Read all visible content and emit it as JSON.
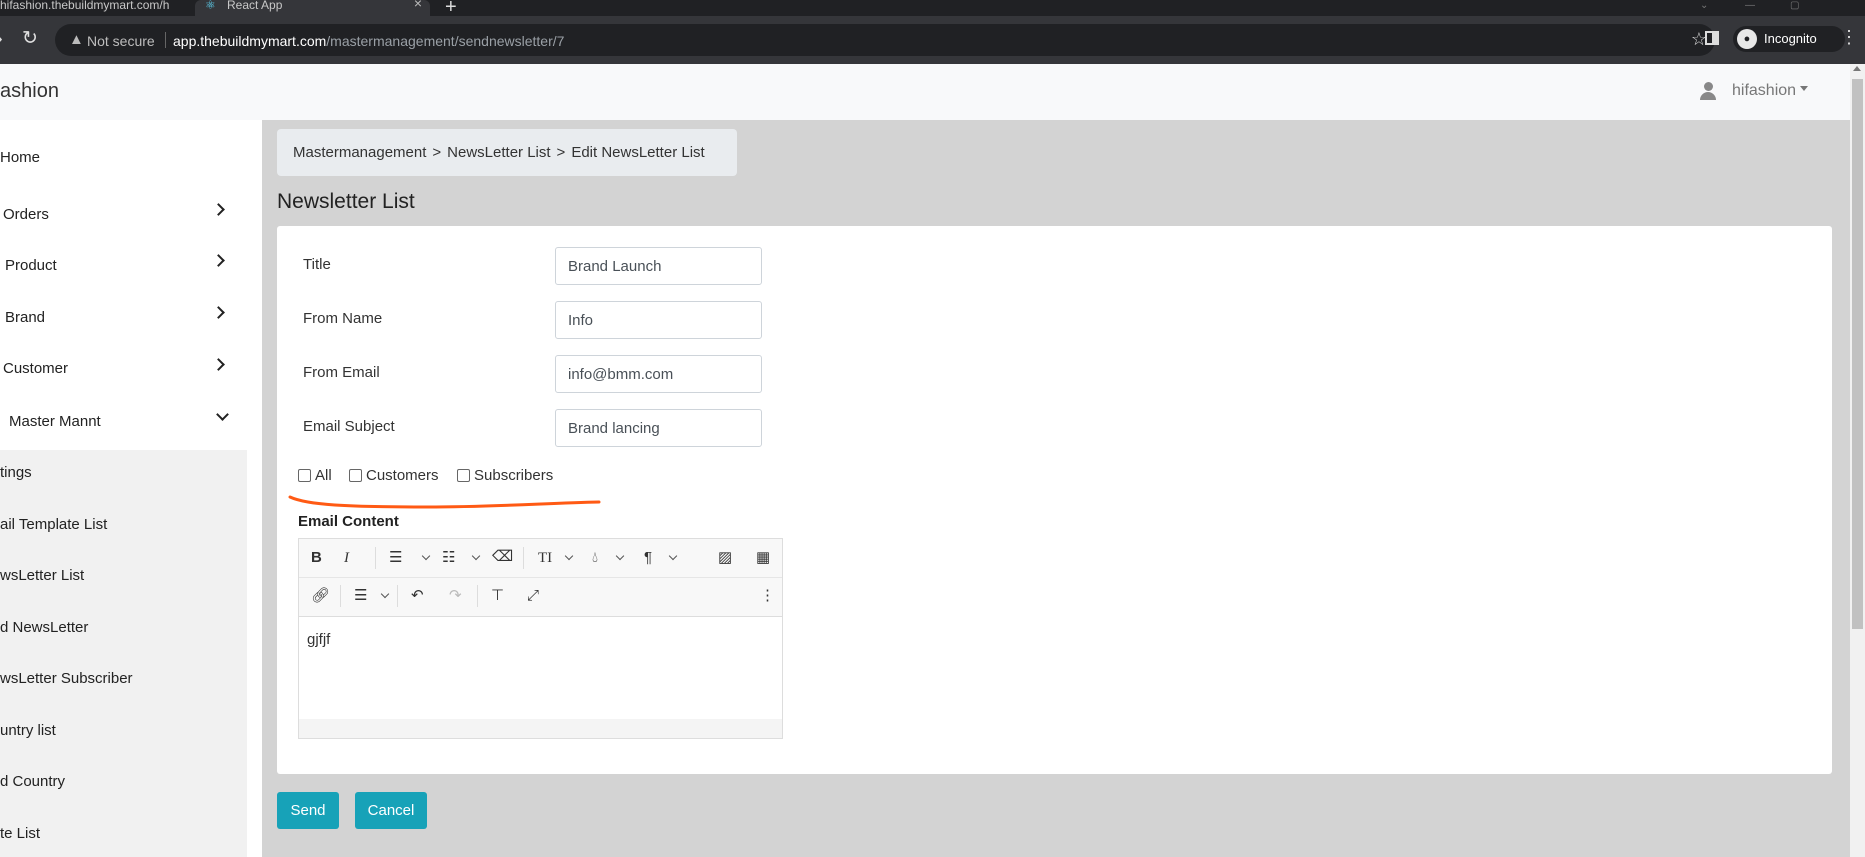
{
  "browser": {
    "tabs": [
      {
        "label": "hifashion.thebuildmymart.com/h"
      },
      {
        "label": "React App"
      }
    ],
    "security_label": "Not secure",
    "url_host": "app.thebuildmymart.com",
    "url_path": "/mastermanagement/sendnewsletter/7",
    "profile_label": "Incognito"
  },
  "header": {
    "brand": "ashion",
    "username": "hifashion"
  },
  "sidebar": {
    "items": [
      {
        "label": "Home"
      },
      {
        "label": "Orders"
      },
      {
        "label": "Product"
      },
      {
        "label": "Brand"
      },
      {
        "label": "Customer"
      },
      {
        "label": "Master Mannt"
      }
    ],
    "subitems": [
      {
        "label": "tings"
      },
      {
        "label": "ail Template List"
      },
      {
        "label": "wsLetter List"
      },
      {
        "label": "d NewsLetter"
      },
      {
        "label": "wsLetter Subscriber"
      },
      {
        "label": "untry list"
      },
      {
        "label": "d Country"
      },
      {
        "label": "te List"
      }
    ]
  },
  "breadcrumb": {
    "items": [
      "Mastermanagement",
      "NewsLetter List",
      "Edit NewsLetter List"
    ],
    "separator": ">"
  },
  "page_title": "Newsletter List",
  "form": {
    "fields": [
      {
        "label": "Title",
        "value": "Brand Launch"
      },
      {
        "label": "From Name",
        "value": "Info"
      },
      {
        "label": "From Email",
        "value": "info@bmm.com"
      },
      {
        "label": "Email Subject",
        "value": "Brand lancing"
      }
    ],
    "recipients": [
      {
        "label": "All",
        "checked": false
      },
      {
        "label": "Customers",
        "checked": false
      },
      {
        "label": "Subscribers",
        "checked": false
      }
    ],
    "email_content_label": "Email Content",
    "email_content_text": "gjfjf"
  },
  "editor_toolbar": {
    "bold": "B",
    "italic": "I",
    "font_size": "TI",
    "paragraph": "¶"
  },
  "buttons": {
    "send": "Send",
    "cancel": "Cancel"
  },
  "colors": {
    "accent": "#17a2b8",
    "annotation": "#ff5a14"
  }
}
